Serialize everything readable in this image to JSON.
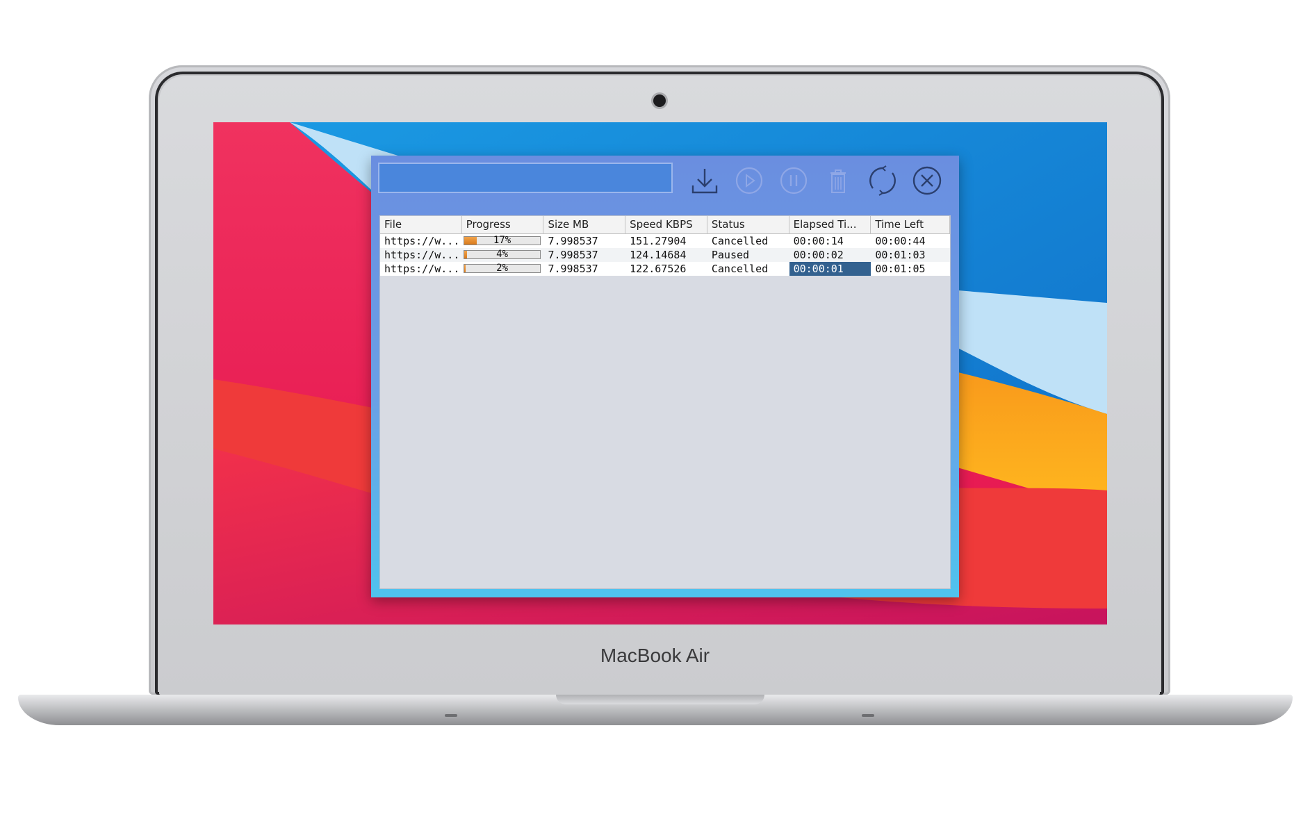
{
  "device": {
    "brand_label": "MacBook Air"
  },
  "colors": {
    "window_gradient_top": "#6a8ee0",
    "window_gradient_bottom": "#4fc3ee",
    "selection": "#33618f",
    "progress_fill": "#e38a2a"
  },
  "toolbar": {
    "url_value": "",
    "buttons": [
      {
        "name": "download-icon",
        "enabled": true
      },
      {
        "name": "play-icon",
        "enabled": false
      },
      {
        "name": "pause-icon",
        "enabled": false
      },
      {
        "name": "trash-icon",
        "enabled": false
      },
      {
        "name": "refresh-icon",
        "enabled": true
      },
      {
        "name": "close-icon",
        "enabled": true
      }
    ]
  },
  "table": {
    "columns": [
      "File",
      "Progress",
      "Size MB",
      "Speed KBPS",
      "Status",
      "Elapsed Ti...",
      "Time Left"
    ],
    "rows": [
      {
        "file": "https://w...",
        "progress": 17,
        "progress_label": "17%",
        "size": "7.998537",
        "speed": "151.27904",
        "status": "Cancelled",
        "elapsed": "00:00:14",
        "left": "00:00:44"
      },
      {
        "file": "https://w...",
        "progress": 4,
        "progress_label": "4%",
        "size": "7.998537",
        "speed": "124.14684",
        "status": "Paused",
        "elapsed": "00:00:02",
        "left": "00:01:03"
      },
      {
        "file": "https://w...",
        "progress": 2,
        "progress_label": "2%",
        "size": "7.998537",
        "speed": "122.67526",
        "status": "Cancelled",
        "elapsed": "00:00:01",
        "left": "00:01:05"
      }
    ],
    "selected_cell": {
      "row": 2,
      "column": "elapsed"
    }
  }
}
